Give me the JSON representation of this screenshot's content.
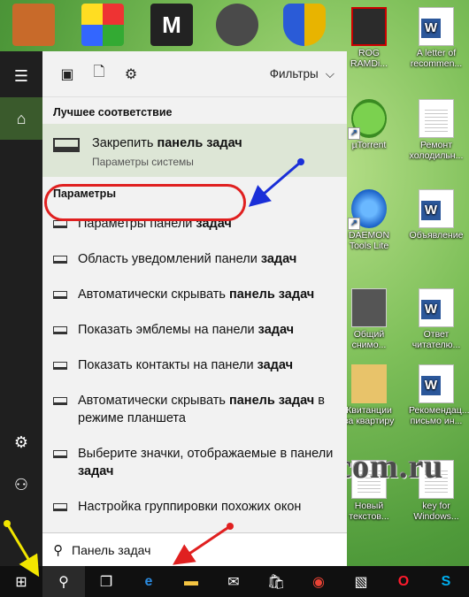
{
  "panel": {
    "filters_label": "Фильтры",
    "best_match_header": "Лучшее соответствие",
    "best_match": {
      "title_plain": "Закрепить ",
      "title_bold": "панель задач",
      "subtitle": "Параметры системы"
    },
    "settings_header": "Параметры",
    "items": [
      {
        "plain": "Параметры панели ",
        "bold": "задач",
        "tail": ""
      },
      {
        "plain": "Область уведомлений панели ",
        "bold": "задач",
        "tail": ""
      },
      {
        "plain": "Автоматически скрывать ",
        "bold": "панель задач",
        "tail": ""
      },
      {
        "plain": "Показать эмблемы на панели ",
        "bold": "задач",
        "tail": ""
      },
      {
        "plain": "Показать контакты на панели ",
        "bold": "задач",
        "tail": ""
      },
      {
        "plain": "Автоматически скрывать ",
        "bold": "панель задач",
        "tail": " в режиме планшета"
      },
      {
        "plain": "Выберите значки, отображаемые в панели ",
        "bold": "задач",
        "tail": ""
      },
      {
        "plain": "Настройка группировки похожих окон",
        "bold": "",
        "tail": ""
      }
    ]
  },
  "search": {
    "value": "Панель задач"
  },
  "desktop_icons": {
    "rog": "ROG RAMDi...",
    "letter": "A letter of recommen...",
    "utorrent": "µTorrent",
    "repair": "Ремонт холодильн...",
    "daemon": "DAEMON Tools Lite",
    "announce": "Объявление",
    "shared": "Общий снимо...",
    "reply": "Ответ читателю...",
    "receipts": "Квитанции за квартиру",
    "recommend": "Рекомендац... письмо ин...",
    "new_text": "Новый текстов...",
    "keyforwin": "key for Windows..."
  },
  "watermark": "Moicom.ru",
  "colors": {
    "accent_green": "#3a5a2c",
    "highlight_ring": "#e02020",
    "arrow_blue": "#1a2fd8",
    "arrow_yellow": "#f2e600"
  }
}
